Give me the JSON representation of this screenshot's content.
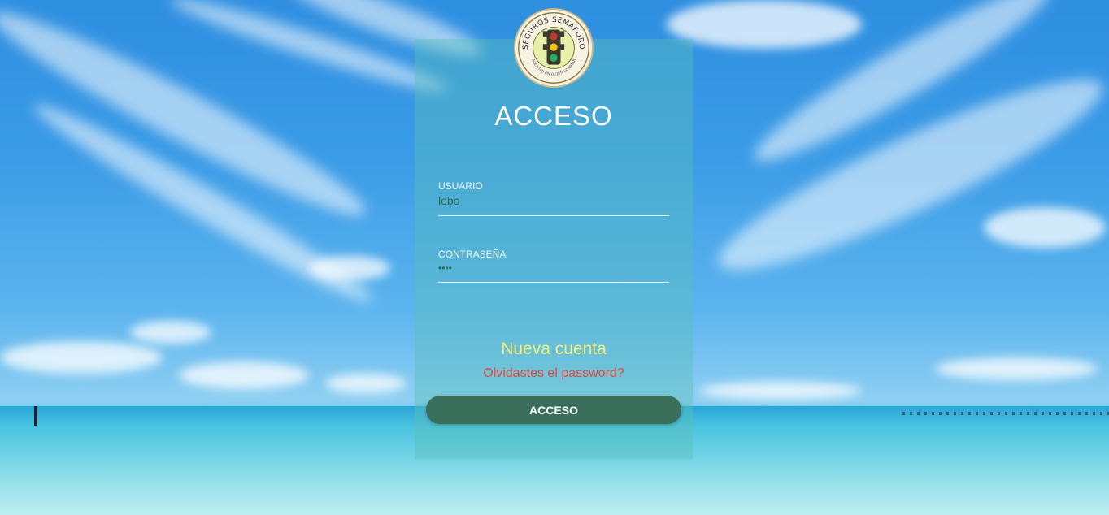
{
  "login": {
    "logo_top_text": "SEGUROS SEMAFORO",
    "logo_bottom_text": "AGENTES EN QUIEN CONFIAR",
    "title": "ACCESO",
    "username": {
      "label": "USUARIO",
      "value": "lobo"
    },
    "password": {
      "label": "CONTRASEÑA",
      "value": "••••"
    },
    "new_account_label": "Nueva cuenta",
    "forgot_password_label": "Olvidastes el password?",
    "submit_label": "ACCESO"
  },
  "colors": {
    "accent_yellow": "#f4ee78",
    "link_red": "#e24a3c",
    "button_green": "#3a6f5c",
    "input_text": "#2f6b4a"
  },
  "icons": {
    "logo": "traffic-light-seal-icon"
  }
}
